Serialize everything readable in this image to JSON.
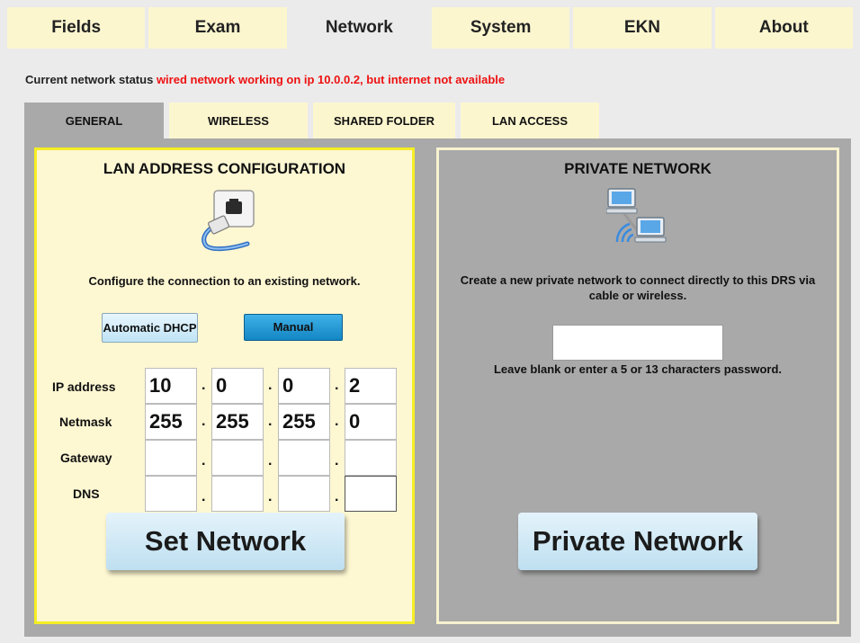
{
  "top_tabs": [
    {
      "label": "Fields",
      "active": false
    },
    {
      "label": "Exam",
      "active": false
    },
    {
      "label": "Network",
      "active": true
    },
    {
      "label": "System",
      "active": false
    },
    {
      "label": "EKN",
      "active": false
    },
    {
      "label": "About",
      "active": false
    }
  ],
  "status": {
    "prefix": "Current network status",
    "message": "wired network working on ip 10.0.0.2, but internet not available",
    "message_color": "#ee1111"
  },
  "sub_tabs": [
    {
      "label": "GENERAL",
      "active": true
    },
    {
      "label": "WIRELESS",
      "active": false
    },
    {
      "label": "SHARED FOLDER",
      "active": false
    },
    {
      "label": "LAN ACCESS",
      "active": false
    }
  ],
  "lan": {
    "title": "LAN ADDRESS CONFIGURATION",
    "icon": "ethernet-cable-icon",
    "description": "Configure the connection to an existing network.",
    "mode_auto": "Automatic DHCP",
    "mode_manual": "Manual",
    "selected_mode": "Manual",
    "fields": [
      {
        "label": "IP address",
        "values": [
          "10",
          "0",
          "0",
          "2"
        ]
      },
      {
        "label": "Netmask",
        "values": [
          "255",
          "255",
          "255",
          "0"
        ]
      },
      {
        "label": "Gateway",
        "values": [
          "",
          "",
          "",
          ""
        ]
      },
      {
        "label": "DNS",
        "values": [
          "",
          "",
          "",
          ""
        ]
      }
    ],
    "separator": ".",
    "button": "Set Network"
  },
  "private": {
    "title": "PRIVATE NETWORK",
    "icon": "wireless-computers-icon",
    "description": "Create a new private network to connect directly to this DRS via cable or wireless.",
    "password_value": "",
    "hint": "Leave blank or enter a 5 or 13 characters password.",
    "button": "Private Network"
  },
  "colors": {
    "tab_bg": "#fcf6cf",
    "panel_gray": "#a9a9a9",
    "lan_border": "#f5ee24",
    "manual_blue": "#1386c4"
  }
}
